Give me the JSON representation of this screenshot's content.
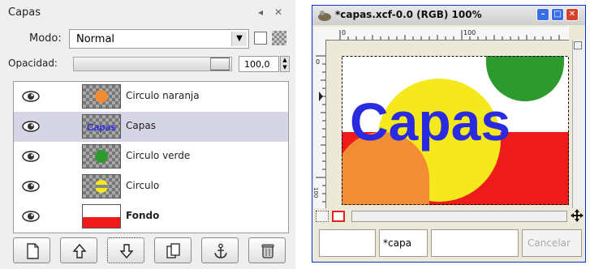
{
  "layers_dialog": {
    "title": "Capas",
    "mode_label": "Modo:",
    "mode_value": "Normal",
    "opacity_label": "Opacidad:",
    "opacity_value": "100,0",
    "opacity_level": 1.0,
    "layers": [
      {
        "name": "Circulo naranja",
        "bold": false,
        "selected": false
      },
      {
        "name": "Capas",
        "bold": false,
        "selected": true,
        "thumb_text": "Capas"
      },
      {
        "name": "Circulo verde",
        "bold": false,
        "selected": false
      },
      {
        "name": "Circulo",
        "bold": false,
        "selected": false
      },
      {
        "name": "Fondo",
        "bold": true,
        "selected": false
      }
    ],
    "buttons": [
      "new-layer",
      "raise-layer",
      "lower-layer",
      "duplicate-layer",
      "anchor-layer",
      "delete-layer"
    ]
  },
  "image_window": {
    "title": "*capas.xcf-0.0 (RGB) 100%",
    "ruler_h_labels": [
      "0",
      "100"
    ],
    "ruler_v_labels": [
      "0",
      "100"
    ],
    "canvas_text": "Capas",
    "status_layer": "*capa",
    "cancel_label": "Cancelar"
  },
  "colors": {
    "canvas_text": "#2a2be0",
    "red": "#ef1b1b",
    "yellow": "#f5e81c",
    "orange": "#f28c35",
    "green": "#2c9a2c",
    "selection": "#d5d5e6",
    "xp_blue": "#0831d9"
  }
}
